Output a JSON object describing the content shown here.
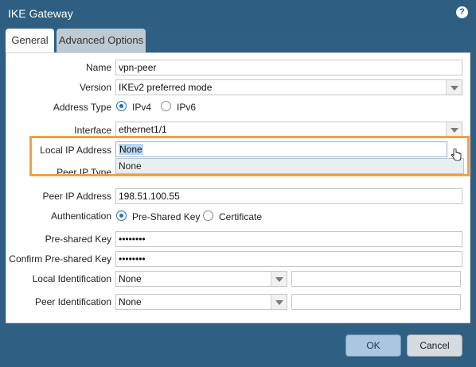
{
  "window": {
    "title": "IKE Gateway",
    "help_icon": "?"
  },
  "tabs": [
    {
      "label": "General",
      "active": true
    },
    {
      "label": "Advanced Options",
      "active": false
    }
  ],
  "form": {
    "name": {
      "label": "Name",
      "value": "vpn-peer"
    },
    "version": {
      "label": "Version",
      "value": "IKEv2 preferred mode"
    },
    "address_type": {
      "label": "Address Type",
      "options": [
        "IPv4",
        "IPv6"
      ],
      "selected": "IPv4"
    },
    "interface": {
      "label": "Interface",
      "value": "ethernet1/1"
    },
    "local_ip": {
      "label": "Local IP Address",
      "value": "None",
      "dropdown_option": "None"
    },
    "peer_ip_type": {
      "label": "Peer IP Type"
    },
    "peer_ip": {
      "label": "Peer IP Address",
      "value": "198.51.100.55"
    },
    "authentication": {
      "label": "Authentication",
      "options": [
        "Pre-Shared Key",
        "Certificate"
      ],
      "selected": "Pre-Shared Key"
    },
    "psk": {
      "label": "Pre-shared Key",
      "value": "••••••••"
    },
    "confirm_psk": {
      "label": "Confirm Pre-shared Key",
      "value": "••••••••"
    },
    "local_id": {
      "label": "Local Identification",
      "value": "None",
      "text": ""
    },
    "peer_id": {
      "label": "Peer Identification",
      "value": "None",
      "text": ""
    }
  },
  "buttons": {
    "ok": "OK",
    "cancel": "Cancel"
  },
  "colors": {
    "titlebar": "#2e5e82",
    "highlight": "#f0a04b",
    "selection": "#bcd6f1"
  }
}
